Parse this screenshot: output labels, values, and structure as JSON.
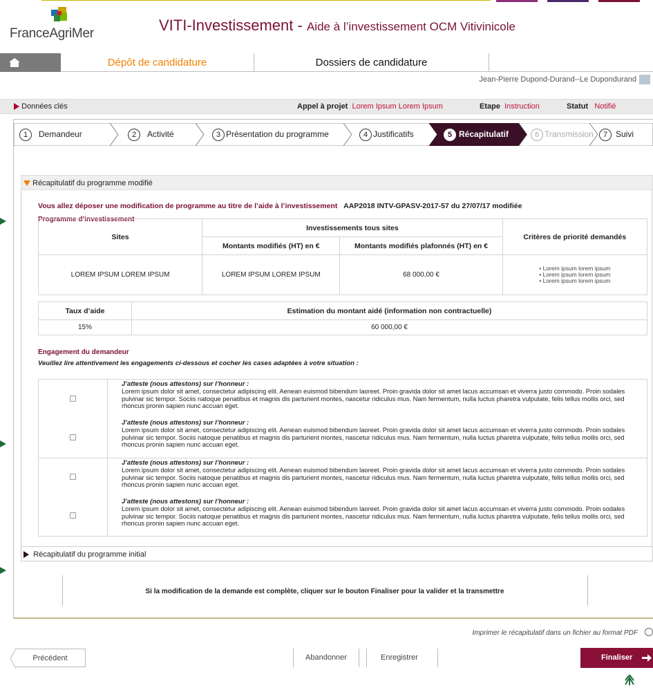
{
  "header": {
    "logo_text": "FranceAgriMer",
    "title_main": "VITI-Investissement - ",
    "title_sub": "Aide à l’investissement OCM Vitivinicole"
  },
  "nav": {
    "tabs": [
      {
        "label": "Dépôt de candidature"
      },
      {
        "label": "Dossiers de candidature"
      }
    ],
    "user": "Jean-Pierre Dupond-Durand--Le Dupondurand"
  },
  "keybar": {
    "label": "Données clés",
    "appel_label": "Appel à projet",
    "appel_value": "Lorem Ipsum  Lorem Ipsum",
    "etape_label": "Etape",
    "etape_value": "Instruction",
    "statut_label": "Statut",
    "statut_value": "Notifié"
  },
  "steps": [
    {
      "num": "1",
      "label": "Demandeur"
    },
    {
      "num": "2",
      "label": "Activité"
    },
    {
      "num": "3",
      "label": "Présentation du programme"
    },
    {
      "num": "4",
      "label": "Justificatifs"
    },
    {
      "num": "5",
      "label": "Récapitulatif"
    },
    {
      "num": "6",
      "label": "Transmission"
    },
    {
      "num": "7",
      "label": "Suivi"
    }
  ],
  "recap": {
    "section_title": "Récapitulatif du programme modifié",
    "intro": "Vous allez déposer une modification de programme au titre de l’aide à l’investissement",
    "intro_ref": "AAP2018 INTV-GPASV-2017-57 du 27/07/17 modifiée",
    "programme_title": "Programme d’investissement",
    "table": {
      "col_sites": "Sites",
      "col_invest": "Investissements tous sites",
      "col_montants": "Montants modifiés (HT) en €",
      "col_plafonnes": "Montants modifiés plafonnés (HT) en €",
      "col_criteres": "Critères de priorité demandés",
      "row_site": "LOREM IPSUM LOREM IPSUM",
      "row_montant": "LOREM IPSUM LOREM IPSUM",
      "row_plafonne": "68 000,00 €",
      "row_criteres": [
        "• Lorem ipsum lorem ipsum",
        "• Lorem ipsum lorem ipsum",
        "• Lorem ipsum lorem ipsum"
      ]
    },
    "aide_table": {
      "col_taux": "Taux d’aide",
      "col_estim": "Estimation du montant aidé (information non contractuelle)",
      "taux": "15%",
      "estim": "60 000,00 €"
    },
    "engagement_title": "Engagement du demandeur",
    "engagement_instr": "Veuillez lire attentivement les engagements ci-dessous et cocher les cases adaptées à votre situation :",
    "engagement_heading": "J’atteste (nous attestons) sur l’honneur :",
    "engagement_body": "Lorem ipsum dolor sit amet, consectetur adipiscing elit. Aenean euismod bibendum laoreet. Proin gravida dolor sit amet lacus accumsan et viverra justo commodo. Proin sodales pulvinar sic tempor. Sociis natoque penatibus et magnis dis parturient montes, nascetur ridiculus mus. Nam fermentum, nulla luctus pharetra vulputate, felis tellus mollis orci, sed rhoncus pronin sapien nunc accuan eget."
  },
  "initial_section": "Récapitulatif du programme initial",
  "finalize_note": "Si la modification de la demande est complète, cliquer sur le bouton Finaliser pour la valider et la transmettre",
  "print_note": "Imprimer le récapitulatif dans un fichier au format PDF",
  "buttons": {
    "precedent": "Précédent",
    "abandonner": "Abandonner",
    "enregistrer": "Enregistrer",
    "finaliser": "Finaliser"
  },
  "colors": {
    "brand": "#7a1236",
    "active_step": "#3a1026",
    "finalize": "#8a1038"
  }
}
